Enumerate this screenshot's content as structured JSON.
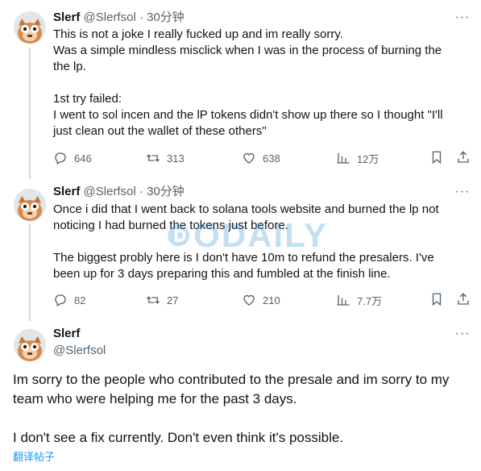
{
  "thread": [
    {
      "name": "Slerf",
      "handle": "@Slerfsol",
      "separator": "·",
      "time": "30分钟",
      "text": "This is not a joke I really fucked up and im really sorry.\nWas a simple mindless misclick when I was in the process of burning the\nthe lp.\n\n1st try failed:\nI went to sol incen and the lP tokens didn't show up there so I thought \"I'll\njust clean out the wallet of these others\"",
      "replies": "646",
      "retweets": "313",
      "likes": "638",
      "views": "12万"
    },
    {
      "name": "Slerf",
      "handle": "@Slerfsol",
      "separator": "·",
      "time": "30分钟",
      "text": "Once i did that I went back to solana tools website and burned the lp not\nnoticing I had burned the tokens just before.\n\nThe biggest probly here is I don't have 10m to refund the presalers. I've\nbeen up for 3 days preparing this and fumbled at the finish line.",
      "replies": "82",
      "retweets": "27",
      "likes": "210",
      "views": "7.7万"
    }
  ],
  "main_tweet": {
    "name": "Slerf",
    "handle": "@Slerfsol",
    "text": "Im sorry to the people who contributed to the presale and im sorry to my\nteam who were helping me for the past 3 days.\n\nI don't see a fix currently. Don't even think it's possible.",
    "translate_label": "翻译帖子"
  },
  "watermark_text": "ODAILY",
  "colors": {
    "text": "#0f1419",
    "secondary": "#536471",
    "link": "#1d9bf0",
    "thread_line": "#cfd9de"
  },
  "icons": [
    "more-icon",
    "reply-icon",
    "retweet-icon",
    "like-icon",
    "views-icon",
    "bookmark-icon",
    "share-icon",
    "avatar-cat"
  ]
}
